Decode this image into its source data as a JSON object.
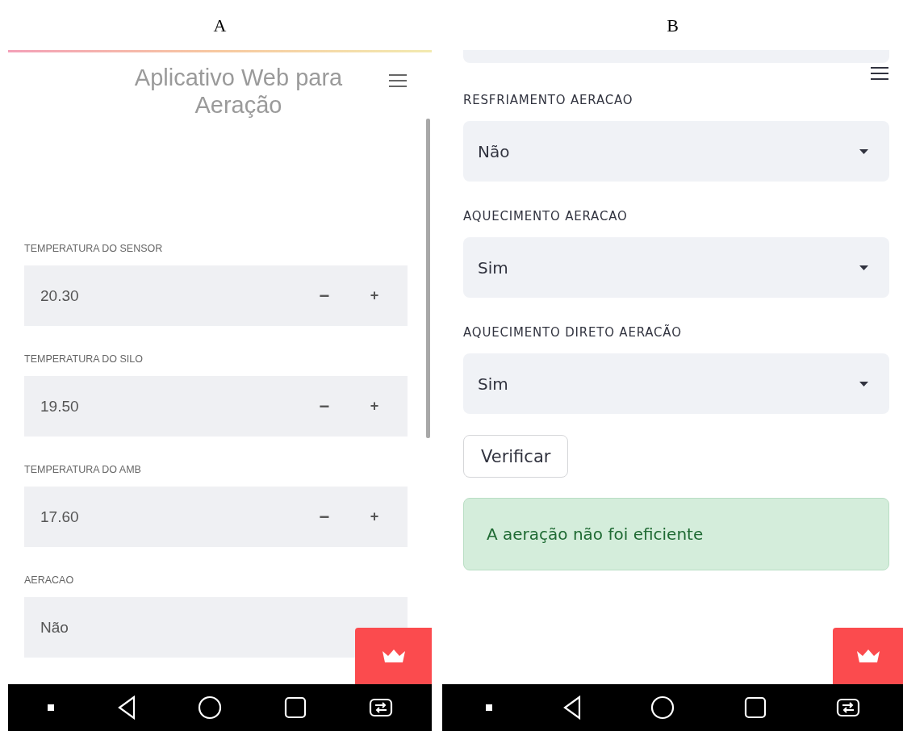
{
  "figure_labels": [
    "A",
    "B"
  ],
  "panel_a": {
    "title": "Aplicativo Web para Aeração",
    "fields": [
      {
        "kind": "number",
        "label": "TEMPERATURA DO SENSOR",
        "value": "20.30",
        "minus": "−",
        "plus": "+"
      },
      {
        "kind": "number",
        "label": "TEMPERATURA DO SILO",
        "value": "19.50",
        "minus": "−",
        "plus": "+"
      },
      {
        "kind": "number",
        "label": "TEMPERATURA DO AMB",
        "value": "17.60",
        "minus": "−",
        "plus": "+"
      },
      {
        "kind": "select",
        "label": "AERACAO",
        "value": "Não"
      }
    ]
  },
  "panel_b": {
    "fields": [
      {
        "kind": "select",
        "label": "RESFRIAMENTO AERACAO",
        "value": "Não",
        "caret": true
      },
      {
        "kind": "select",
        "label": "AQUECIMENTO AERACAO",
        "value": "Sim",
        "caret": true
      },
      {
        "kind": "select",
        "label": "AQUECIMENTO DIRETO AERACÃO",
        "value": "Sim",
        "caret": true
      }
    ],
    "button": "Verificar",
    "alert": "A aeração não foi eficiente"
  }
}
